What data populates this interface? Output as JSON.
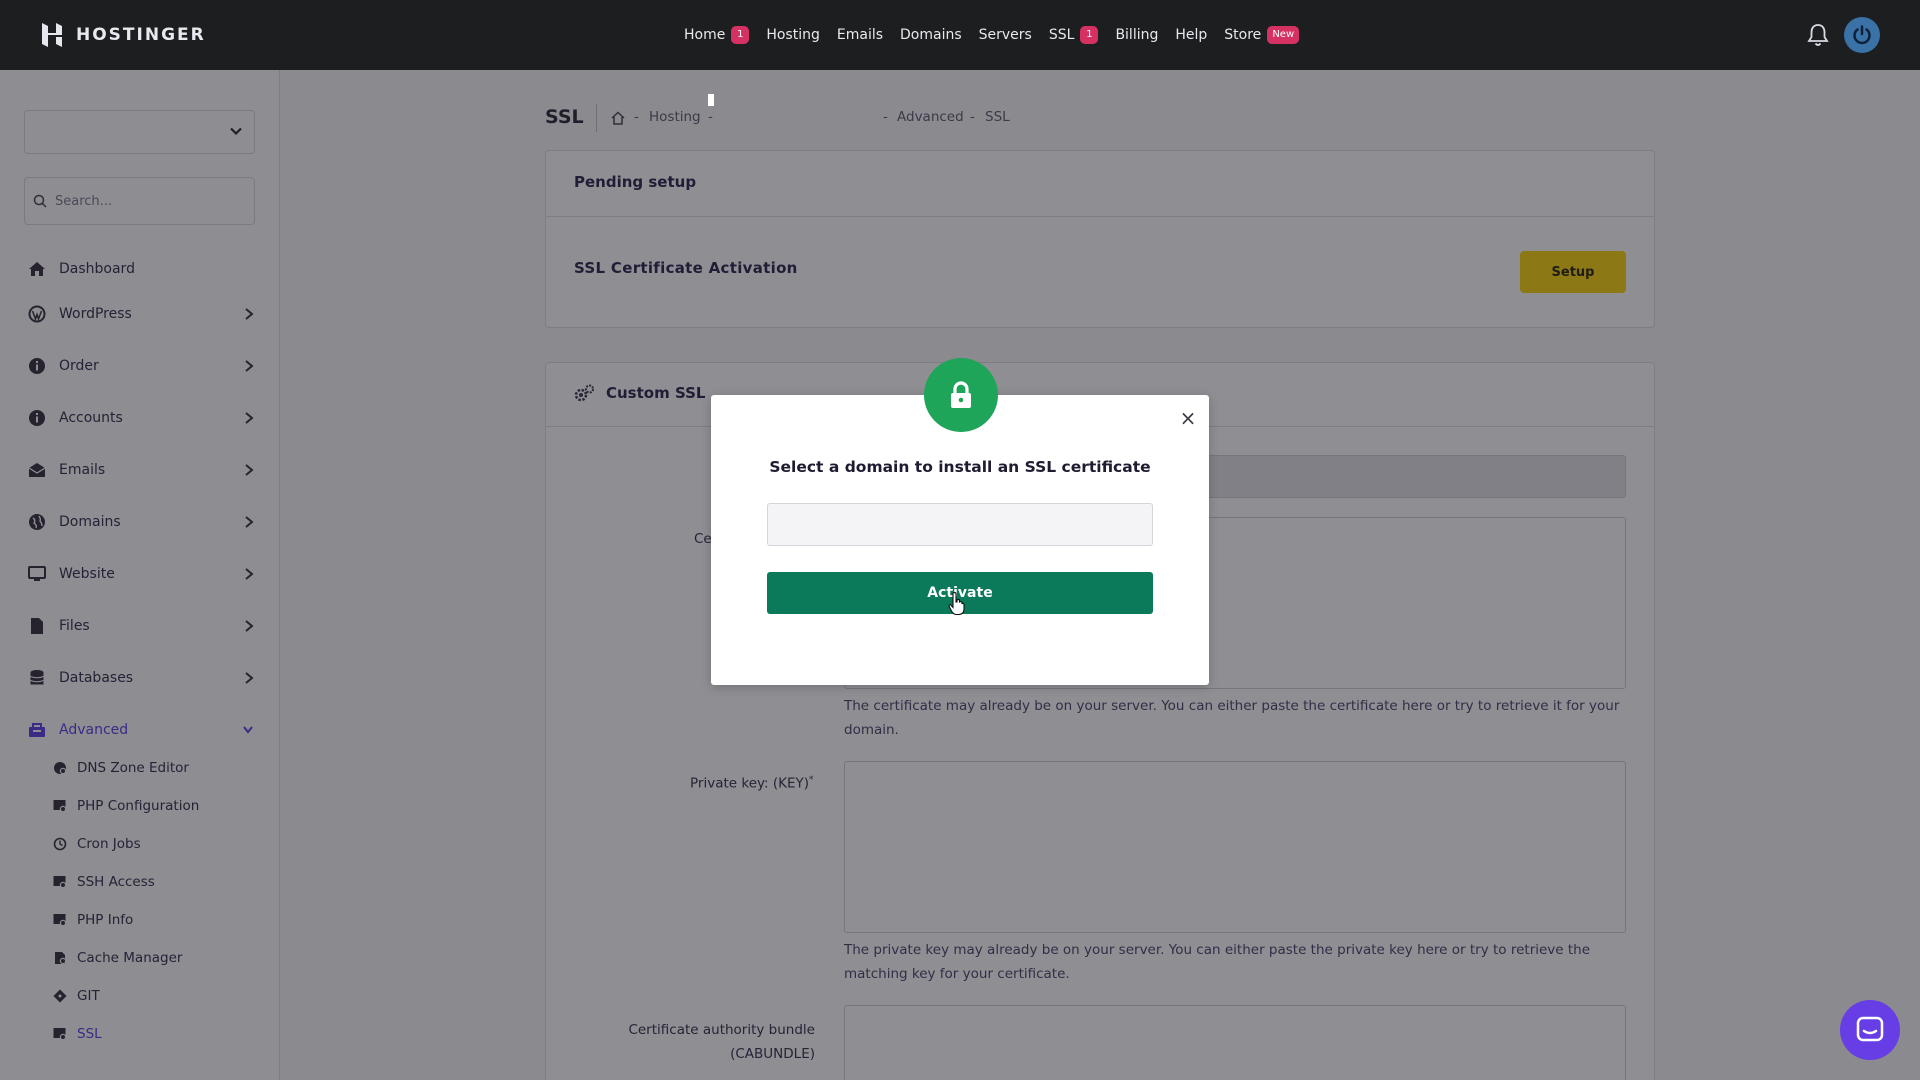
{
  "brand": {
    "name": "HOSTINGER"
  },
  "topnav": {
    "items": [
      {
        "label": "Home",
        "badge": "1"
      },
      {
        "label": "Hosting"
      },
      {
        "label": "Emails"
      },
      {
        "label": "Domains"
      },
      {
        "label": "Servers"
      },
      {
        "label": "SSL",
        "badge": "1"
      },
      {
        "label": "Billing"
      },
      {
        "label": "Help"
      },
      {
        "label": "Store",
        "badge": "New"
      }
    ]
  },
  "sidebar": {
    "search_placeholder": "Search...",
    "items": [
      {
        "label": "Dashboard",
        "icon": "home-icon"
      },
      {
        "label": "WordPress",
        "icon": "wordpress-icon"
      },
      {
        "label": "Order",
        "icon": "info-icon"
      },
      {
        "label": "Accounts",
        "icon": "info-icon"
      },
      {
        "label": "Emails",
        "icon": "mail-icon"
      },
      {
        "label": "Domains",
        "icon": "globe-icon"
      },
      {
        "label": "Website",
        "icon": "monitor-icon"
      },
      {
        "label": "Files",
        "icon": "file-icon"
      },
      {
        "label": "Databases",
        "icon": "database-icon"
      },
      {
        "label": "Advanced",
        "icon": "advanced-icon"
      }
    ],
    "sub_items": [
      {
        "label": "DNS Zone Editor"
      },
      {
        "label": "PHP Configuration"
      },
      {
        "label": "Cron Jobs"
      },
      {
        "label": "SSH Access"
      },
      {
        "label": "PHP Info"
      },
      {
        "label": "Cache Manager"
      },
      {
        "label": "GIT"
      },
      {
        "label": "SSL"
      }
    ]
  },
  "page": {
    "title": "SSL",
    "breadcrumb": {
      "hosting": "Hosting",
      "advanced": "Advanced",
      "ssl": "SSL",
      "sep": "-"
    }
  },
  "pending": {
    "title": "Pending setup",
    "row_label": "SSL Certificate Activation",
    "button": "Setup"
  },
  "custom_ssl": {
    "title": "Custom SSL",
    "cert_label_fragment": "Ce",
    "cert_help": "The certificate may already be on your server. You can either paste the certificate here or try to retrieve it for your domain.",
    "key_label": "Private key: (KEY)",
    "required_mark": "*",
    "key_help": "The private key may already be on your server. You can either paste the private key here or try to retrieve the matching key for your certificate.",
    "cabundle_label_line1": "Certificate authority bundle",
    "cabundle_label_line2": "(CABUNDLE)"
  },
  "modal": {
    "heading": "Select a domain to install an SSL certificate",
    "button": "Activate",
    "close": "×"
  },
  "colors": {
    "topbar": "#1d1e20",
    "accent_purple": "#673de6",
    "activate_green": "#0b7a5a",
    "lock_green": "#1ea55a",
    "badge_pink": "#d63163"
  }
}
